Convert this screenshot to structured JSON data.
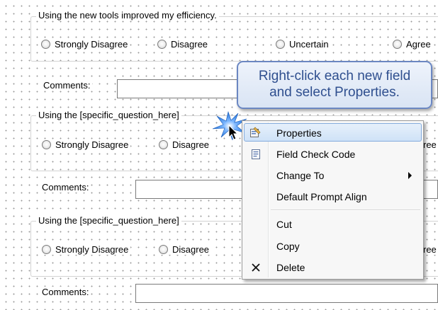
{
  "scale_options": [
    "Strongly Disagree",
    "Disagree",
    "Uncertain",
    "Agree"
  ],
  "question1": {
    "title": "Using the new tools improved my efficiency."
  },
  "question2": {
    "title": "Using the [specific_question_here]"
  },
  "question3": {
    "title": "Using the [specific_question_here]"
  },
  "comments_label": "Comments:",
  "partial_text": "ree",
  "callout": {
    "line1": "Right-click each new field",
    "line2": "and select Properties."
  },
  "context_menu": {
    "items": [
      {
        "label": "Properties",
        "icon": "properties-icon",
        "highlighted": true
      },
      {
        "label": "Field Check Code",
        "icon": "check-code-icon"
      },
      {
        "label": "Change To",
        "submenu": true
      },
      {
        "label": "Default Prompt Align"
      },
      {
        "label": "Cut"
      },
      {
        "label": "Copy"
      },
      {
        "label": "Delete",
        "icon": "delete-x-icon"
      }
    ]
  },
  "colors": {
    "callout_text": "#2f4f8f",
    "callout_border": "#6b87c2",
    "menu_highlight_border": "#84acdd",
    "click_burst": "#1f6fd6"
  }
}
